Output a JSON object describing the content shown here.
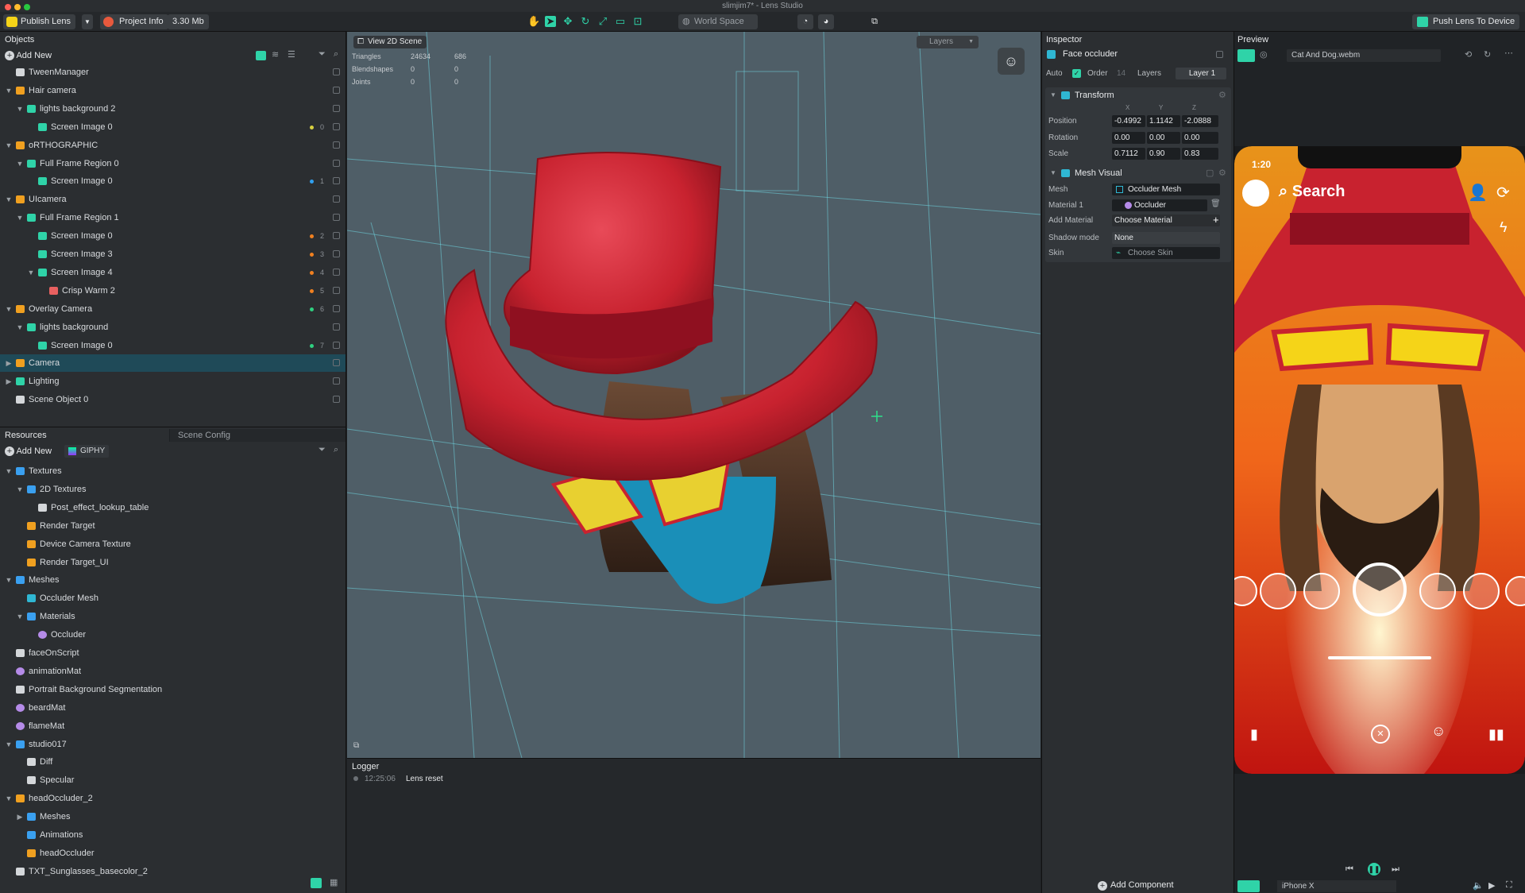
{
  "window": {
    "title": "slimjim7* - Lens Studio"
  },
  "toolbar": {
    "publish": "Publish Lens",
    "project_info": "Project Info",
    "size": "3.30 Mb",
    "space": "World Space",
    "push": "Push Lens To Device"
  },
  "objects": {
    "title": "Objects",
    "add_new": "Add New",
    "items": [
      {
        "label": "TweenManager",
        "depth": 0,
        "caret": "",
        "icon": "object",
        "layer": ""
      },
      {
        "label": "Hair camera",
        "depth": 0,
        "caret": "▼",
        "icon": "camera",
        "layer": ""
      },
      {
        "label": "lights background 2",
        "depth": 1,
        "caret": "▼",
        "icon": "region",
        "layer": ""
      },
      {
        "label": "Screen Image 0",
        "depth": 2,
        "caret": "",
        "icon": "image",
        "layer": "0"
      },
      {
        "label": "oRTHOGRAPHIC",
        "depth": 0,
        "caret": "▼",
        "icon": "camera",
        "layer": ""
      },
      {
        "label": "Full Frame Region 0",
        "depth": 1,
        "caret": "▼",
        "icon": "region",
        "layer": ""
      },
      {
        "label": "Screen Image 0",
        "depth": 2,
        "caret": "",
        "icon": "image",
        "layer": "1"
      },
      {
        "label": "UIcamera",
        "depth": 0,
        "caret": "▼",
        "icon": "camera",
        "layer": ""
      },
      {
        "label": "Full Frame Region 1",
        "depth": 1,
        "caret": "▼",
        "icon": "region",
        "layer": ""
      },
      {
        "label": "Screen Image 0",
        "depth": 2,
        "caret": "",
        "icon": "image",
        "layer": "2"
      },
      {
        "label": "Screen Image 3",
        "depth": 2,
        "caret": "",
        "icon": "image",
        "layer": "3"
      },
      {
        "label": "Screen Image 4",
        "depth": 2,
        "caret": "▼",
        "icon": "image",
        "layer": "4"
      },
      {
        "label": "Crisp Warm 2",
        "depth": 3,
        "caret": "",
        "icon": "effect",
        "layer": "5"
      },
      {
        "label": "Overlay Camera",
        "depth": 0,
        "caret": "▼",
        "icon": "camera",
        "layer": "6"
      },
      {
        "label": "lights background",
        "depth": 1,
        "caret": "▼",
        "icon": "region",
        "layer": ""
      },
      {
        "label": "Screen Image 0",
        "depth": 2,
        "caret": "",
        "icon": "image",
        "layer": "7"
      },
      {
        "label": "Camera",
        "depth": 0,
        "caret": "▶",
        "icon": "camera",
        "layer": ""
      },
      {
        "label": "Lighting",
        "depth": 0,
        "caret": "▶",
        "icon": "light",
        "layer": ""
      },
      {
        "label": "Scene Object 0",
        "depth": 0,
        "caret": "",
        "icon": "object",
        "layer": ""
      }
    ]
  },
  "resources": {
    "title": "Resources",
    "scene_config": "Scene Config",
    "add_new": "Add New",
    "giphy": "GIPHY",
    "items": [
      {
        "label": "Textures",
        "depth": 0,
        "caret": "▼",
        "icon": "folder"
      },
      {
        "label": "2D Textures",
        "depth": 1,
        "caret": "▼",
        "icon": "folder"
      },
      {
        "label": "Post_effect_lookup_table",
        "depth": 2,
        "caret": "",
        "icon": "texture"
      },
      {
        "label": "Render Target",
        "depth": 1,
        "caret": "",
        "icon": "render"
      },
      {
        "label": "Device Camera Texture",
        "depth": 1,
        "caret": "",
        "icon": "render"
      },
      {
        "label": "Render Target_UI",
        "depth": 1,
        "caret": "",
        "icon": "render"
      },
      {
        "label": "Meshes",
        "depth": 0,
        "caret": "▼",
        "icon": "folder"
      },
      {
        "label": "Occluder Mesh",
        "depth": 1,
        "caret": "",
        "icon": "mesh"
      },
      {
        "label": "Materials",
        "depth": 1,
        "caret": "▼",
        "icon": "folder"
      },
      {
        "label": "Occluder",
        "depth": 2,
        "caret": "",
        "icon": "material"
      },
      {
        "label": "faceOnScript",
        "depth": 0,
        "caret": "",
        "icon": "script"
      },
      {
        "label": "animationMat",
        "depth": 0,
        "caret": "",
        "icon": "material"
      },
      {
        "label": "Portrait Background Segmentation",
        "depth": 0,
        "caret": "",
        "icon": "texture"
      },
      {
        "label": "beardMat",
        "depth": 0,
        "caret": "",
        "icon": "material"
      },
      {
        "label": "flameMat",
        "depth": 0,
        "caret": "",
        "icon": "material"
      },
      {
        "label": "studio017",
        "depth": 0,
        "caret": "▼",
        "icon": "folder"
      },
      {
        "label": "Diff",
        "depth": 1,
        "caret": "",
        "icon": "texture"
      },
      {
        "label": "Specular",
        "depth": 1,
        "caret": "",
        "icon": "texture"
      },
      {
        "label": "headOccluder_2",
        "depth": 0,
        "caret": "▼",
        "icon": "asset"
      },
      {
        "label": "Meshes",
        "depth": 1,
        "caret": "▶",
        "icon": "folder"
      },
      {
        "label": "Animations",
        "depth": 1,
        "caret": "",
        "icon": "folder"
      },
      {
        "label": "headOccluder",
        "depth": 1,
        "caret": "",
        "icon": "asset"
      },
      {
        "label": "TXT_Sunglasses_basecolor_2",
        "depth": 0,
        "caret": "",
        "icon": "texture"
      }
    ]
  },
  "viewport": {
    "view_2d": "View 2D Scene",
    "layers": "Layers",
    "stats": [
      {
        "name": "Triangles",
        "a": "24634",
        "b": "686"
      },
      {
        "name": "Blendshapes",
        "a": "0",
        "b": "0"
      },
      {
        "name": "Joints",
        "a": "0",
        "b": "0"
      }
    ]
  },
  "logger": {
    "title": "Logger",
    "time": "12:25:06",
    "message": "Lens reset"
  },
  "inspector": {
    "title": "Inspector",
    "object_name": "Face occluder",
    "auto": "Auto",
    "order_label": "Order",
    "order_value": "14",
    "layers_label": "Layers",
    "layer_value": "Layer 1",
    "transform": {
      "title": "Transform",
      "axes": [
        "X",
        "Y",
        "Z"
      ],
      "position_label": "Position",
      "position": [
        "-0.4992",
        "1.1142",
        "-2.0888"
      ],
      "rotation_label": "Rotation",
      "rotation": [
        "0.00",
        "0.00",
        "0.00"
      ],
      "scale_label": "Scale",
      "scale": [
        "0.7112",
        "0.90",
        "0.83"
      ]
    },
    "mesh_visual": {
      "title": "Mesh Visual",
      "mesh_label": "Mesh",
      "mesh_value": "Occluder Mesh",
      "material_label": "Material 1",
      "material_value": "Occluder",
      "add_material_label": "Add Material",
      "add_material_value": "Choose Material",
      "shadow_label": "Shadow mode",
      "shadow_value": "None",
      "skin_label": "Skin",
      "skin_value": "Choose Skin"
    },
    "add_component": "Add Component"
  },
  "preview": {
    "title": "Preview",
    "video": "Cat And Dog.webm",
    "device": "iPhone X",
    "phone_time": "1:20",
    "search": "Search"
  },
  "colors": {
    "accent": "#2fd3a8",
    "selection": "#1f4a58",
    "hat": "#d42a3a"
  }
}
